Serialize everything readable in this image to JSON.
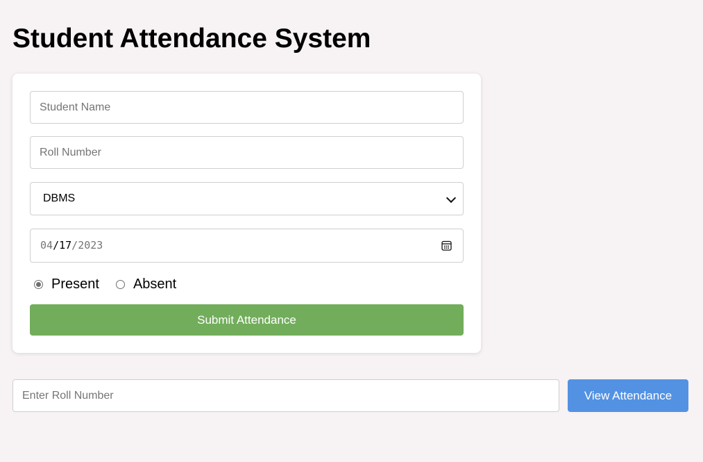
{
  "page": {
    "title": "Student Attendance System"
  },
  "form": {
    "student_name_placeholder": "Student Name",
    "roll_number_placeholder": "Roll Number",
    "subject_selected": "DBMS",
    "date": {
      "month": "04",
      "day": "17",
      "year": "2023",
      "sep": "/"
    },
    "status_options": [
      {
        "label": "Present",
        "checked": true
      },
      {
        "label": "Absent",
        "checked": false
      }
    ],
    "submit_label": "Submit Attendance",
    "submit_color": "#72ad5b"
  },
  "lookup": {
    "roll_placeholder": "Enter Roll Number",
    "view_label": "View Attendance",
    "view_color": "#5392e3"
  },
  "icons": {
    "calendar": "calendar-icon",
    "dropdown": "chevron-down-icon"
  }
}
